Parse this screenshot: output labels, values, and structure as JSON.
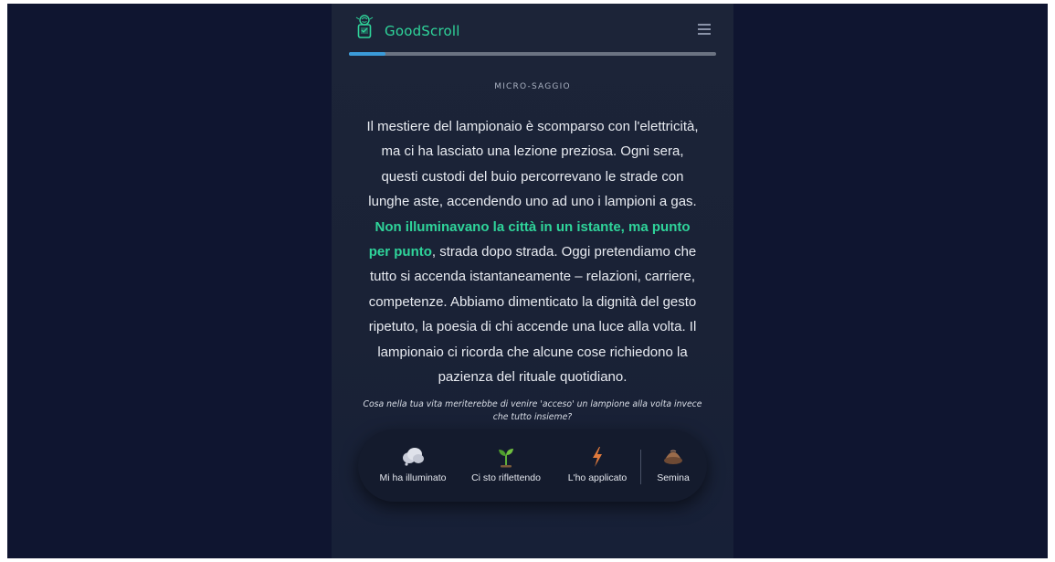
{
  "header": {
    "brand": "GoodScroll",
    "logo_icon": "phone-brain-icon",
    "menu_icon": "hamburger-menu-icon",
    "accent_color": "#2fd49a",
    "reading_progress": 0.1
  },
  "essay": {
    "eyebrow": "MICRO-SAGGIO",
    "text_before": "Il mestiere del lampionaio è scomparso con l'elettricità, ma ci ha lasciato una lezione preziosa. Ogni sera, questi custodi del buio percorrevano le strade con lunghe aste, accendendo uno ad uno i lampioni a gas. ",
    "highlight": "Non illuminavano la città in un istante, ma punto per punto",
    "text_after": ", strada dopo strada. Oggi pretendiamo che tutto si accenda istantaneamente – relazioni, carriere, competenze. Abbiamo dimenticato la dignità del gesto ripetuto, la poesia di chi accende una luce alla volta. Il lampionaio ci ricorda che alcune cose richiedono la pazienza del rituale quotidiano."
  },
  "prompt": "Cosa nella tua vita meriterebbe di venire 'acceso' un lampione alla volta invece che tutto insieme?",
  "reactions": [
    {
      "label": "Mi ha illuminato",
      "icon": "cloud-icon"
    },
    {
      "label": "Ci sto riflettendo",
      "icon": "sprout-icon"
    },
    {
      "label": "L'ho applicato",
      "icon": "lightning-icon"
    },
    {
      "label": "Semina",
      "icon": "seed-icon"
    }
  ]
}
